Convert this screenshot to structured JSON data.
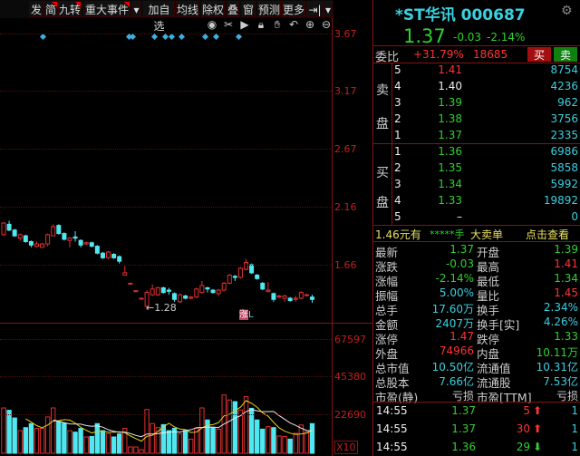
{
  "toolbar": {
    "buttons": [
      "发",
      "简",
      "九转",
      "重大事件",
      "▾",
      "加自选",
      "均线",
      "除权",
      "叠",
      "窗",
      "预测",
      "更多",
      "⇥|",
      "▾"
    ]
  },
  "tools": [
    "eye-icon",
    "scissors-icon",
    "play-icon",
    "lock-icon",
    "hand-icon",
    "undo-icon",
    "zoom-in-icon",
    "zoom-out-icon"
  ],
  "price_axis": [
    "3.67",
    "3.17",
    "2.67",
    "2.16",
    "1.66"
  ],
  "volume_axis": [
    "67597",
    "45380",
    "22690",
    "X10"
  ],
  "low_marker": "1.28",
  "limit_marker": {
    "text": "涨",
    "suffix": "L"
  },
  "colors": {
    "up": "#e03030",
    "down": "#50e8f0",
    "ma5": "#e0d020",
    "ma10": "#e8e8e8",
    "axis": "#c02020"
  },
  "chart_data": {
    "type": "candlestick",
    "ohlc": [
      [
        1.93,
        2.03,
        2.04,
        1.92
      ],
      [
        2.02,
        1.97,
        2.05,
        1.96
      ],
      [
        1.97,
        1.92,
        1.98,
        1.91
      ],
      [
        1.9,
        1.93,
        1.94,
        1.88
      ],
      [
        1.92,
        1.87,
        1.93,
        1.86
      ],
      [
        1.87,
        1.84,
        1.88,
        1.82
      ],
      [
        1.83,
        1.85,
        1.87,
        1.82
      ],
      [
        1.82,
        1.85,
        1.86,
        1.82
      ],
      [
        1.85,
        1.93,
        1.94,
        1.83
      ],
      [
        1.92,
        2.0,
        2.02,
        1.92
      ],
      [
        2.01,
        1.94,
        2.02,
        1.93
      ],
      [
        1.94,
        1.89,
        1.95,
        1.88
      ],
      [
        1.88,
        1.9,
        1.91,
        1.82
      ],
      [
        1.91,
        1.9,
        1.96,
        1.87
      ],
      [
        1.88,
        1.84,
        1.89,
        1.82
      ],
      [
        1.85,
        1.86,
        1.87,
        1.84
      ],
      [
        1.86,
        1.83,
        1.87,
        1.82
      ],
      [
        1.83,
        1.77,
        1.84,
        1.76
      ],
      [
        1.77,
        1.73,
        1.78,
        1.72
      ],
      [
        1.73,
        1.78,
        1.79,
        1.72
      ],
      [
        1.76,
        1.73,
        1.77,
        1.72
      ],
      [
        1.74,
        1.7,
        1.75,
        1.68
      ],
      [
        1.58,
        1.6,
        1.66,
        1.58
      ],
      [
        1.51,
        1.51,
        1.51,
        1.51
      ],
      [
        1.445,
        1.445,
        1.445,
        1.445
      ],
      [
        1.38,
        1.38,
        1.38,
        1.38
      ],
      [
        1.31,
        1.43,
        1.45,
        1.28
      ],
      [
        1.41,
        1.46,
        1.5,
        1.4
      ],
      [
        1.41,
        1.47,
        1.48,
        1.4
      ],
      [
        1.47,
        1.43,
        1.48,
        1.42
      ],
      [
        1.45,
        1.44,
        1.47,
        1.41
      ],
      [
        1.42,
        1.37,
        1.43,
        1.35
      ],
      [
        1.35,
        1.41,
        1.42,
        1.34
      ],
      [
        1.4,
        1.38,
        1.41,
        1.37
      ],
      [
        1.38,
        1.39,
        1.4,
        1.37
      ],
      [
        1.39,
        1.46,
        1.47,
        1.38
      ],
      [
        1.43,
        1.49,
        1.53,
        1.42
      ],
      [
        1.47,
        1.46,
        1.48,
        1.43
      ],
      [
        1.45,
        1.43,
        1.46,
        1.42
      ],
      [
        1.42,
        1.45,
        1.46,
        1.4
      ],
      [
        1.45,
        1.51,
        1.52,
        1.44
      ],
      [
        1.51,
        1.58,
        1.59,
        1.5
      ],
      [
        1.57,
        1.56,
        1.58,
        1.53
      ],
      [
        1.56,
        1.64,
        1.65,
        1.55
      ],
      [
        1.63,
        1.69,
        1.72,
        1.62
      ],
      [
        1.67,
        1.6,
        1.68,
        1.59
      ],
      [
        1.58,
        1.55,
        1.59,
        1.54
      ],
      [
        1.51,
        1.46,
        1.52,
        1.45
      ],
      [
        1.44,
        1.45,
        1.52,
        1.43
      ],
      [
        1.42,
        1.37,
        1.43,
        1.35
      ],
      [
        1.39,
        1.4,
        1.41,
        1.38
      ],
      [
        1.38,
        1.4,
        1.41,
        1.35
      ],
      [
        1.38,
        1.36,
        1.39,
        1.35
      ],
      [
        1.37,
        1.38,
        1.4,
        1.35
      ],
      [
        1.38,
        1.43,
        1.44,
        1.37
      ],
      [
        1.41,
        1.41,
        1.42,
        1.4
      ],
      [
        1.39,
        1.37,
        1.41,
        1.34
      ]
    ],
    "volume": [
      27200,
      25800,
      21200,
      13600,
      15400,
      17800,
      14900,
      15000,
      21800,
      27200,
      19000,
      18000,
      13600,
      12700,
      14900,
      9800,
      10100,
      17800,
      13600,
      11800,
      9800,
      11600,
      15000,
      3800,
      3800,
      2200,
      26300,
      17800,
      15400,
      17200,
      13600,
      15000,
      11600,
      13600,
      8500,
      15000,
      27200,
      20000,
      15400,
      14500,
      35000,
      32000,
      31000,
      26000,
      34000,
      27000,
      20000,
      14500,
      16000,
      15400,
      10400,
      10100,
      8500,
      12000,
      17000,
      13000,
      17800
    ],
    "price_range": [
      1.2,
      3.67
    ],
    "volume_range": [
      0,
      67597
    ],
    "ma_periods": [
      5,
      10
    ]
  },
  "quote": {
    "title": "*ST华讯 000687",
    "price": "1.37",
    "change": "-0.03",
    "change_pct": "-2.14%",
    "wb_label": "委比",
    "wb_pct": "+31.79%",
    "wb_diff": "18685",
    "buy_btn": "买",
    "sell_btn": "卖",
    "sell_label": [
      "卖",
      "盘"
    ],
    "buy_label": [
      "买",
      "盘"
    ],
    "asks": [
      {
        "n": "5",
        "p": "1.41",
        "v": "8754",
        "c": "red"
      },
      {
        "n": "4",
        "p": "1.40",
        "v": "4236",
        "c": "wht"
      },
      {
        "n": "3",
        "p": "1.39",
        "v": "962",
        "c": "grn"
      },
      {
        "n": "2",
        "p": "1.38",
        "v": "3756",
        "c": "grn"
      },
      {
        "n": "1",
        "p": "1.37",
        "v": "2335",
        "c": "grn"
      }
    ],
    "bids": [
      {
        "n": "1",
        "p": "1.36",
        "v": "6986",
        "c": "grn"
      },
      {
        "n": "2",
        "p": "1.35",
        "v": "5858",
        "c": "grn"
      },
      {
        "n": "3",
        "p": "1.34",
        "v": "5992",
        "c": "grn"
      },
      {
        "n": "4",
        "p": "1.33",
        "v": "19892",
        "c": "grn"
      },
      {
        "n": "5",
        "p": "–",
        "v": "0",
        "c": "wht"
      }
    ],
    "big_order": {
      "a": "1.46元有",
      "b": "*****手",
      "c": "大卖单",
      "link": "点击查看"
    },
    "stats": [
      [
        "最新",
        "1.37",
        "grn",
        "开盘",
        "1.39",
        "grn"
      ],
      [
        "涨跌",
        "-0.03",
        "grn",
        "最高",
        "1.41",
        "red"
      ],
      [
        "涨幅",
        "-2.14%",
        "grn",
        "最低",
        "1.34",
        "grn"
      ],
      [
        "振幅",
        "5.00%",
        "cyn",
        "量比",
        "1.45",
        "red"
      ],
      [
        "总手",
        "17.60万",
        "cyn",
        "换手",
        "2.34%",
        "cyn"
      ],
      [
        "金额",
        "2407万",
        "cyn",
        "换手[实]",
        "4.26%",
        "cyn"
      ],
      [
        "涨停",
        "1.47",
        "red",
        "跌停",
        "1.33",
        "grn"
      ],
      [
        "外盘",
        "74966",
        "red",
        "内盘",
        "10.11万",
        "grn"
      ],
      [
        "总市值",
        "10.50亿",
        "cyn",
        "流通值",
        "10.31亿",
        "cyn"
      ],
      [
        "总股本",
        "7.66亿",
        "cyn",
        "流通股",
        "7.53亿",
        "cyn"
      ],
      [
        "市盈(静)",
        "亏损",
        "gry",
        "市盈[TTM]",
        "亏损",
        "gry"
      ]
    ],
    "trades": [
      {
        "t": "14:55",
        "p": "1.37",
        "v": "5",
        "dir": "up",
        "n": "1"
      },
      {
        "t": "14:55",
        "p": "1.37",
        "v": "30",
        "dir": "up",
        "n": "1"
      },
      {
        "t": "14:55",
        "p": "1.36",
        "v": "29",
        "dir": "down",
        "n": "1"
      }
    ]
  }
}
